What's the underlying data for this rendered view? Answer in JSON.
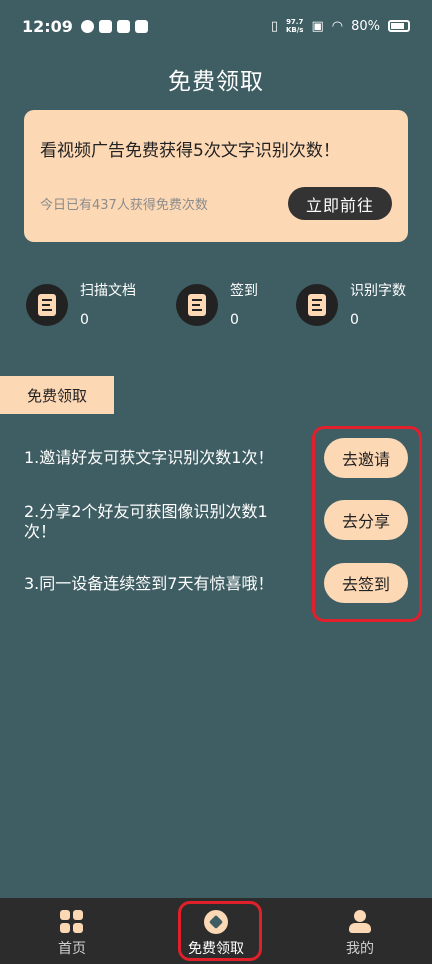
{
  "status_bar": {
    "time": "12:09",
    "net_speed": "97.7",
    "net_unit": "KB/s",
    "battery": "80%"
  },
  "page": {
    "title": "免费领取"
  },
  "ad_card": {
    "headline": "看视频广告免费获得5次文字识别次数！",
    "count_text": "今日已有437人获得免费次数",
    "button_label": "立即前往"
  },
  "stats": [
    {
      "label": "扫描文档",
      "value": "0",
      "icon": "document-icon"
    },
    {
      "label": "签到",
      "value": "0",
      "icon": "document-icon"
    },
    {
      "label": "识别字数",
      "value": "0",
      "icon": "document-icon"
    }
  ],
  "section": {
    "title": "免费领取"
  },
  "tasks": [
    {
      "text": "1.邀请好友可获文字识别次数1次！",
      "button": "去邀请"
    },
    {
      "text": "2.分享2个好友可获图像识别次数1次！",
      "button": "去分享"
    },
    {
      "text": "3.同一设备连续签到7天有惊喜哦！",
      "button": "去签到"
    }
  ],
  "tabbar": {
    "items": [
      {
        "label": "首页",
        "icon": "grid-icon",
        "active": false
      },
      {
        "label": "免费领取",
        "icon": "gift-icon",
        "active": true
      },
      {
        "label": "我的",
        "icon": "person-icon",
        "active": false
      }
    ]
  },
  "colors": {
    "background": "#3f5e63",
    "accent": "#fdd8b5",
    "dark": "#333333",
    "highlight": "#e0202a"
  }
}
